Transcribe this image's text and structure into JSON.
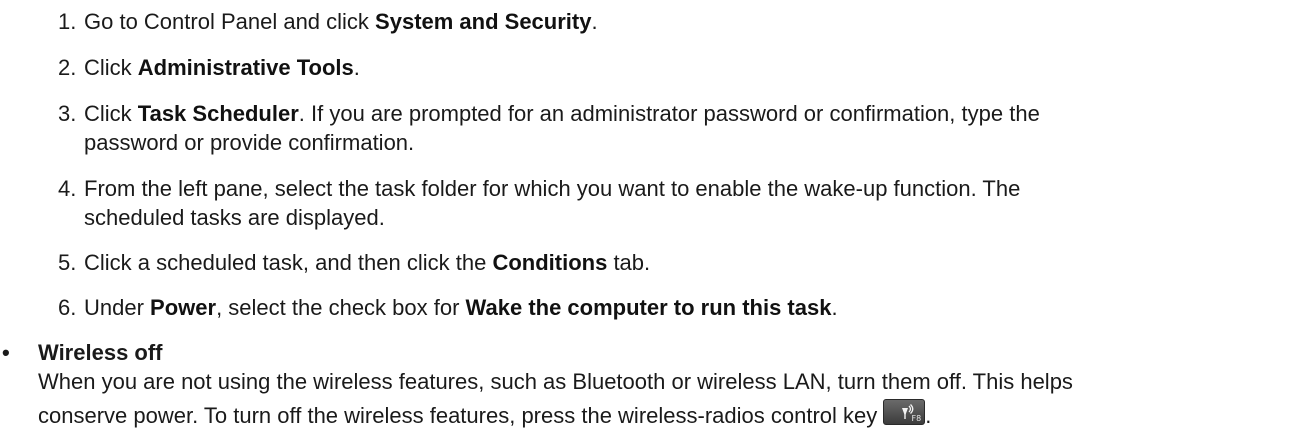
{
  "steps": [
    {
      "num": "1.",
      "pre": "Go to Control Panel and click ",
      "bold": "System and Security",
      "post": "."
    },
    {
      "num": "2.",
      "pre": "Click ",
      "bold": "Administrative Tools",
      "post": "."
    },
    {
      "num": "3.",
      "pre": "Click ",
      "bold": "Task Scheduler",
      "post": ". If you are prompted for an administrator password or confirmation, type the",
      "cont": "password or provide confirmation."
    },
    {
      "num": "4.",
      "pre": "From the left pane, select the task folder for which you want to enable the wake-up function. The",
      "cont": "scheduled tasks are displayed."
    },
    {
      "num": "5.",
      "pre": "Click a scheduled task, and then click the ",
      "bold": "Conditions",
      "post": " tab."
    },
    {
      "num": "6.",
      "pre": "Under ",
      "bold": "Power",
      "mid": ", select the check box for ",
      "bold2": "Wake the computer to run this task",
      "post": "."
    }
  ],
  "bullet": {
    "symbol": "•",
    "title": "Wireless off",
    "line1": "When you are not using the wireless features, such as Bluetooth or wireless LAN, turn them off. This helps",
    "line2": "conserve power. To turn off the wireless features, press the wireless-radios control key",
    "line2_end": ".",
    "key_label": "F8",
    "key_icon": "wireless-radio-icon"
  }
}
